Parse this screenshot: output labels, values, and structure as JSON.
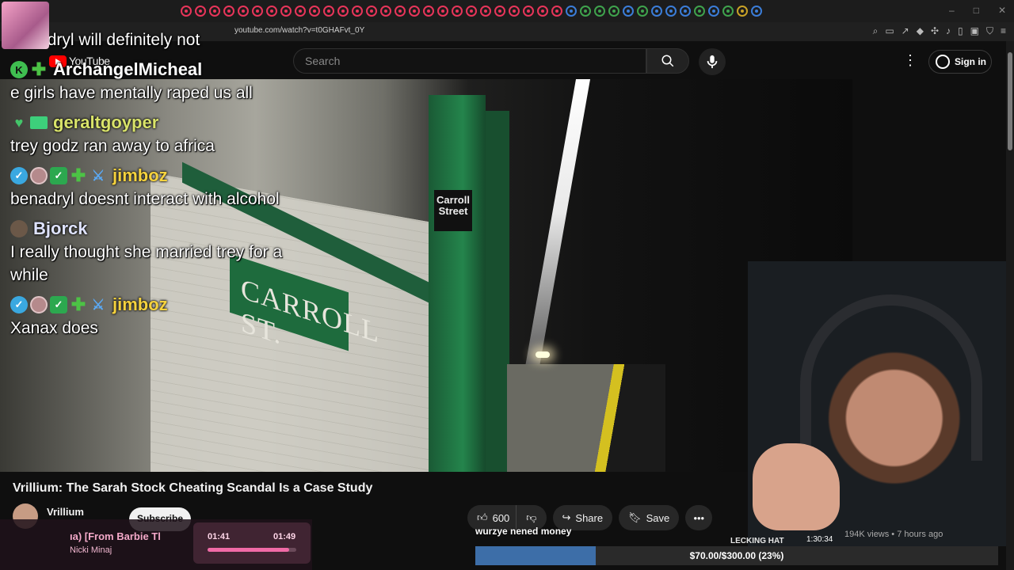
{
  "browser": {
    "url": "youtube.com/watch?v=t0GHAFvt_0Y"
  },
  "youtube": {
    "logo_text": "YouTube",
    "search_placeholder": "Search",
    "sign_in_label": "Sign in"
  },
  "video": {
    "station_sign": "Carroll Street",
    "wall_sign": "CARROLL ST."
  },
  "chat": [
    {
      "user": "",
      "message": "benadryl will definitely not",
      "badges": []
    },
    {
      "user": "ArchangelMicheal",
      "message": "e girls have mentally raped us all",
      "badges": [
        "k-icon",
        "plus-icon"
      ]
    },
    {
      "user": "geraltgoyper",
      "message": "trey godz ran away to africa",
      "badges": [
        "heart-icon",
        "tv-icon"
      ]
    },
    {
      "user": "jimboz",
      "message": "benadryl doesnt interact with alcohol",
      "badges": [
        "verified-icon",
        "avatar-badge",
        "check-icon",
        "plus-icon",
        "sword-icon"
      ]
    },
    {
      "user": "Bjorck",
      "message": "I really thought she married trey for a while",
      "badges": [
        "avatar-badge"
      ]
    },
    {
      "user": "jimboz",
      "message": "Xanax does",
      "badges": [
        "verified-icon",
        "avatar-badge",
        "check-icon",
        "plus-icon",
        "sword-icon"
      ]
    }
  ],
  "details": {
    "title": "Vrillium: The Sarah Stock Cheating Scandal Is a Case Study",
    "channel": "Vrillium",
    "subscribe_label": "Subscribe",
    "like_count": "600",
    "share_label": "Share",
    "save_label": "Save",
    "views_info": "194K views • 7 hours ago"
  },
  "webcam": {
    "timestamp": "1:30:34",
    "label": "LECKING HAT"
  },
  "now_playing": {
    "title": "ıa) [From Barbie Tl",
    "artist": "Nicki Minaj",
    "elapsed": "01:41",
    "total": "01:49",
    "progress": 0.92
  },
  "donation": {
    "ticker": "wurzye nened money",
    "goal_text": "$70.00/$300.00 (23%)",
    "progress": 0.23
  },
  "colors": {
    "jimboz": "#f5d23e",
    "youtube_red": "#ff0000",
    "goal_fill": "#3d6ea8"
  }
}
